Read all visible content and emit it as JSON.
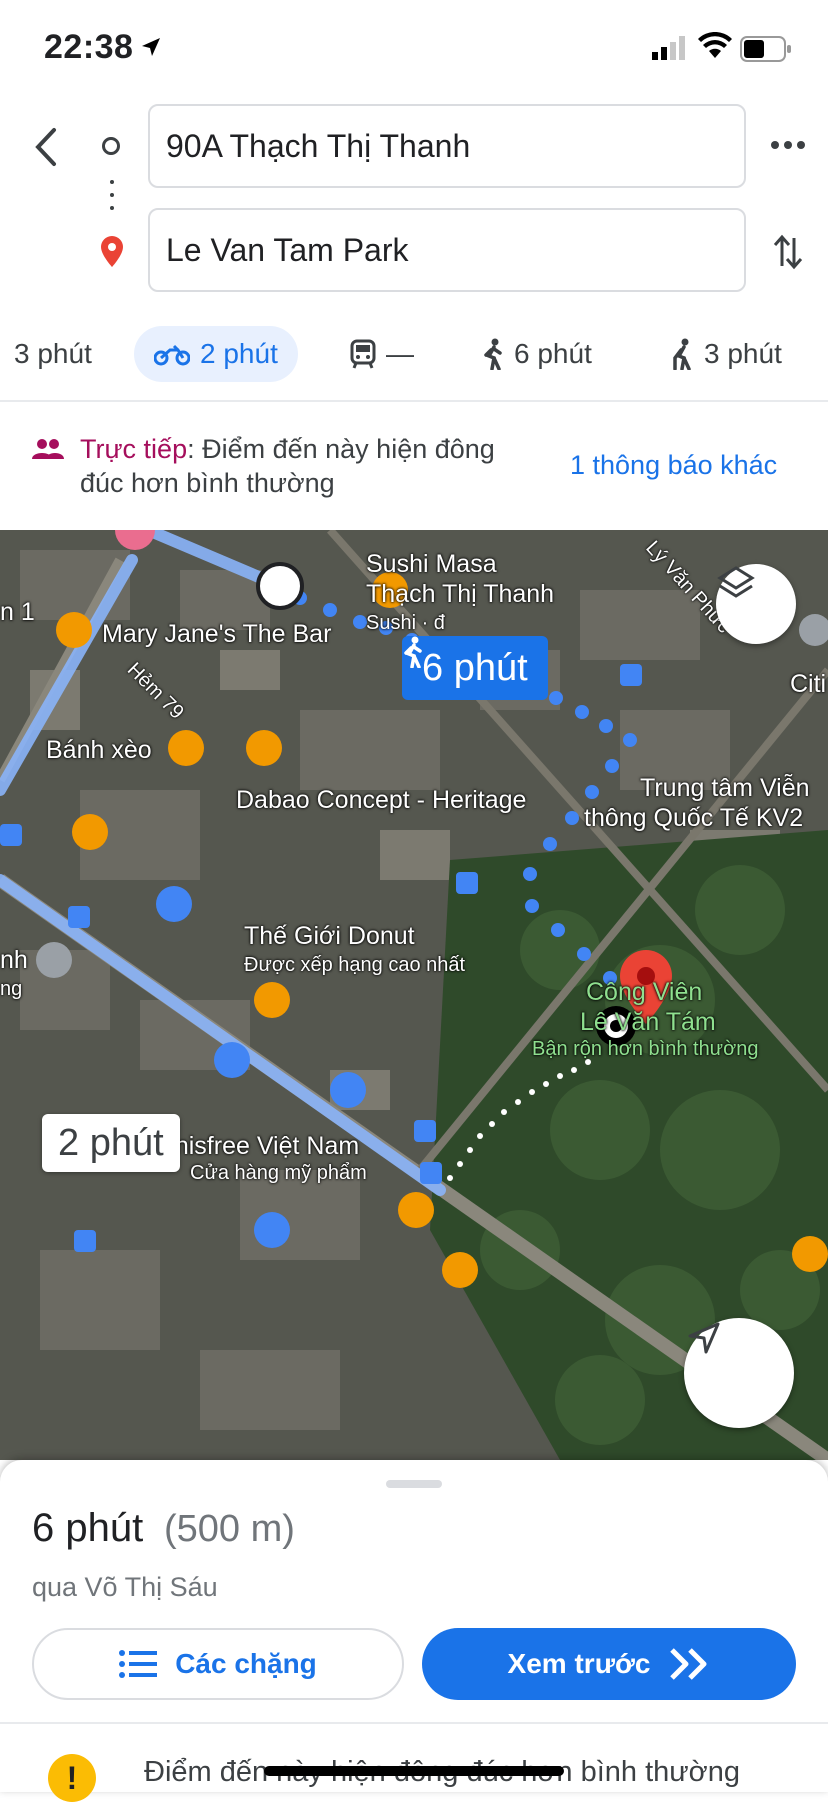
{
  "status_bar": {
    "time": "22:38"
  },
  "directions": {
    "origin": "90A Thạch Thị Thanh",
    "destination": "Le Van Tam Park"
  },
  "modes": [
    {
      "icon": "car-icon",
      "label": "3 phút"
    },
    {
      "icon": "motorbike-icon",
      "label": "2 phút",
      "active": true
    },
    {
      "icon": "transit-icon",
      "label": "—"
    },
    {
      "icon": "walk-icon",
      "label": "6 phút"
    },
    {
      "icon": "ride-icon",
      "label": "3 phút"
    }
  ],
  "alert": {
    "live_label": "Trực tiếp",
    "message_line1": ": Điểm đến này hiện đông",
    "message_line2": "đúc hơn bình thường",
    "link": "1 thông báo khác"
  },
  "map": {
    "walk_badge": "6 phút",
    "moto_badge": "2 phút",
    "labels": {
      "sushi_name": "Sushi Masa",
      "sushi_street": "Thạch Thị Thanh",
      "sushi_sub": "Sushi · đ",
      "mary_jane": "Mary Jane's The Bar",
      "hem79": "Hẻm 79",
      "banh_xeo": "Bánh xèo",
      "dabao": "Dabao Concept - Heritage",
      "trung_tam_1": "Trung tâm Viễn",
      "trung_tam_2": "thông Quốc Tế KV2",
      "ly_van_phuc": "Lý Văn Phức",
      "the_gioi_donut": "Thế Giới Donut",
      "donut_sub": "Được xếp hạng cao nhất",
      "cong_vien_1": "Công Viên",
      "cong_vien_2": "Lê Văn Tám",
      "busy": "Bận rộn hơn bình thường",
      "innisfree": "Innisfree Việt Nam",
      "innisfree_sub": "Cửa hàng mỹ phẩm",
      "citi": "Citi",
      "left_1": "n 1",
      "left_nh": "nh",
      "left_ng": "ng"
    }
  },
  "sheet": {
    "duration": "6 phút",
    "distance": "(500 m)",
    "via": "qua Võ Thị Sáu",
    "steps_button": "Các chặng",
    "preview_button": "Xem trước",
    "warning": "Điểm đến này hiện đông đúc hơn bình thường"
  },
  "colors": {
    "accent": "#1a73e8",
    "live": "#a50e5c",
    "route_walk": "#4285f4",
    "warning": "#fbbc04"
  }
}
